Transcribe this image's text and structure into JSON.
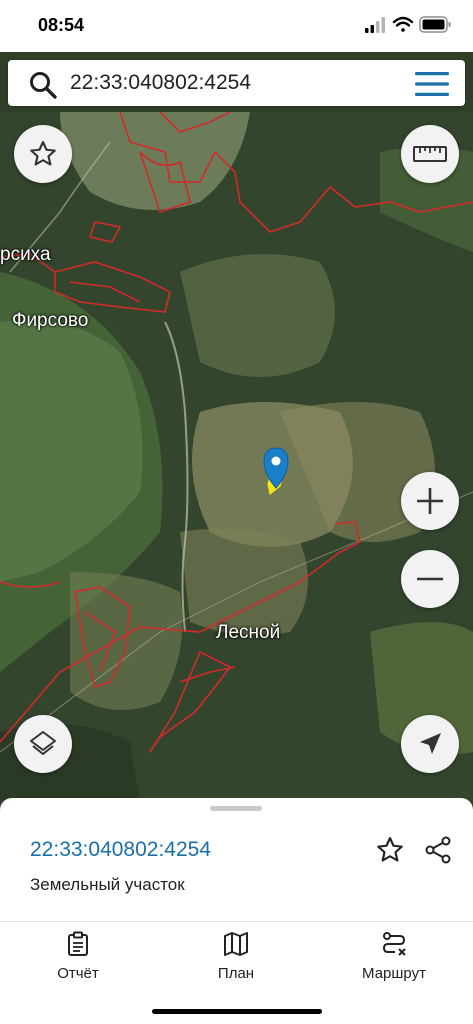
{
  "status_bar": {
    "time": "08:54",
    "icons": [
      "cellular-signal-icon",
      "wifi-icon",
      "battery-icon"
    ]
  },
  "search": {
    "value": "22:33:040802:4254",
    "icon": "search-icon",
    "menu_icon": "hamburger-menu-icon"
  },
  "map": {
    "labels": {
      "village_1": "рсиха",
      "village_2": "Фирсово",
      "village_3": "Лесной"
    },
    "boundary_color": "#d42a2a",
    "marker_color": "#1a7fc8",
    "selected_parcel_color": "#f5e616"
  },
  "map_controls": {
    "favorite": "star-icon",
    "ruler": "ruler-icon",
    "zoom_in": "plus-icon",
    "zoom_out": "minus-icon",
    "layers": "layers-icon",
    "location": "navigation-arrow-icon"
  },
  "bottom_sheet": {
    "parcel_id": "22:33:040802:4254",
    "parcel_type": "Земельный участок",
    "actions": [
      "star-icon",
      "share-icon"
    ]
  },
  "tabs": [
    {
      "label": "Отчёт",
      "icon": "report-clipboard-icon"
    },
    {
      "label": "План",
      "icon": "map-plan-icon"
    },
    {
      "label": "Маршрут",
      "icon": "route-icon"
    }
  ],
  "colors": {
    "accent": "#1b6fa8"
  }
}
